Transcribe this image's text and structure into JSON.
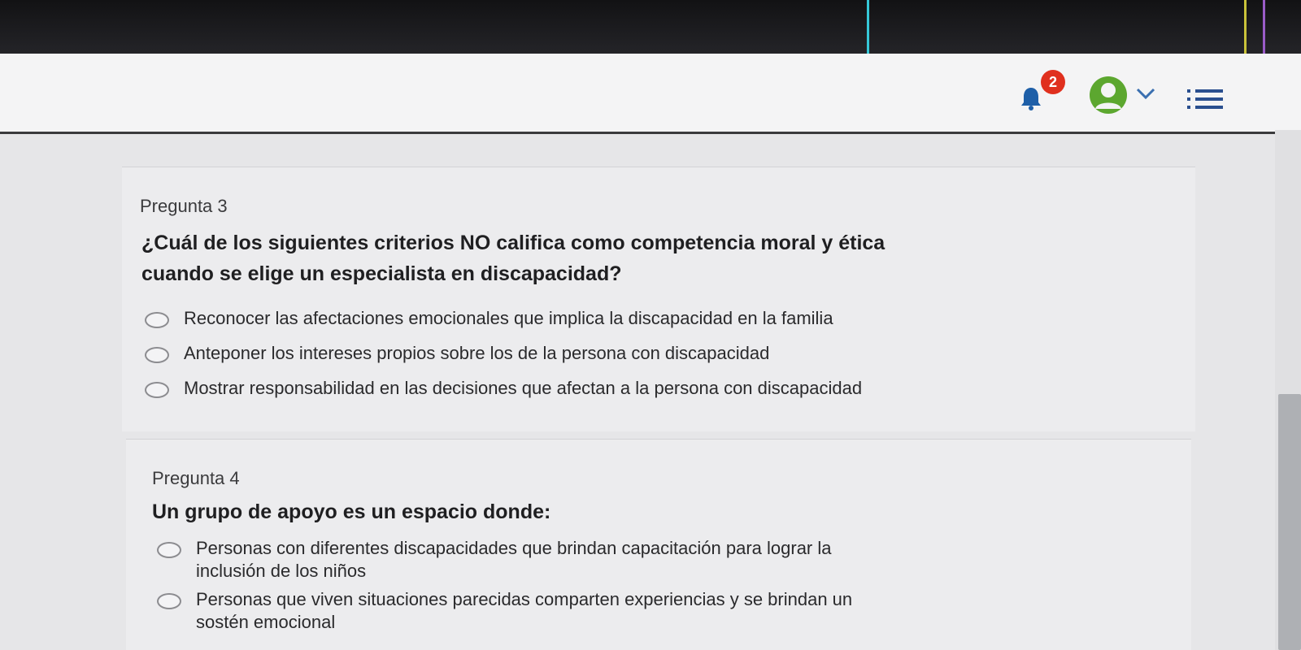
{
  "navbar": {
    "notification_count": "2",
    "icons": [
      "bell-icon",
      "user-avatar-icon",
      "chevron-down-icon",
      "list-menu-icon"
    ],
    "avatar_color": "#5ca72f",
    "badge_color": "#e0301e"
  },
  "questions": [
    {
      "number": "Pregunta 3",
      "text_line1": "¿Cuál de los siguientes criterios NO califica como competencia moral y ética",
      "text_line2": "cuando se elige un especialista en discapacidad?",
      "options": [
        "Reconocer las afectaciones emocionales que implica la discapacidad en la familia",
        "Anteponer los intereses propios sobre los de la persona con discapacidad",
        "Mostrar responsabilidad en las decisiones que afectan a la persona con discapacidad"
      ]
    },
    {
      "number": "Pregunta 4",
      "text_line1": "Un grupo de apoyo es un espacio donde:",
      "options": [
        {
          "line1": "Personas con diferentes discapacidades que brindan capacitación para lograr la",
          "line2": "inclusión de los niños"
        },
        {
          "line1": "Personas que viven situaciones parecidas comparten experiencias y se brindan un",
          "line2": "sostén emocional"
        }
      ]
    }
  ]
}
